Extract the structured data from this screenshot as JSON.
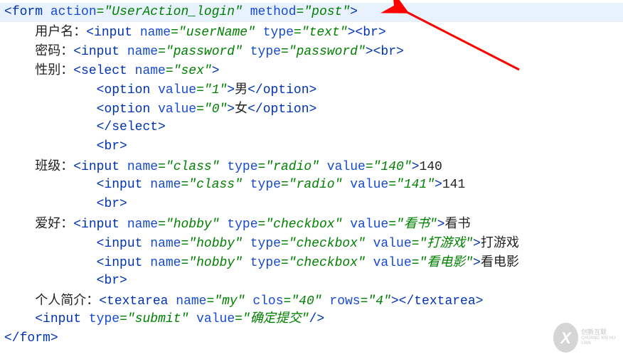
{
  "lines": [
    {
      "indent": 0,
      "tokens": [
        {
          "t": "angle",
          "v": "<"
        },
        {
          "t": "tag",
          "v": "form"
        },
        {
          "t": "txt",
          "v": " "
        },
        {
          "t": "attr",
          "v": "action"
        },
        {
          "t": "eq",
          "v": "="
        },
        {
          "t": "str",
          "v": "\"UserAction_login\""
        },
        {
          "t": "txt",
          "v": " "
        },
        {
          "t": "attr",
          "v": "method"
        },
        {
          "t": "eq",
          "v": "="
        },
        {
          "t": "str",
          "v": "\"post\""
        },
        {
          "t": "angle",
          "v": ">"
        }
      ]
    },
    {
      "indent": 1,
      "tokens": [
        {
          "t": "cjk",
          "v": "用户名："
        },
        {
          "t": "angle",
          "v": "<"
        },
        {
          "t": "tag",
          "v": "input"
        },
        {
          "t": "txt",
          "v": " "
        },
        {
          "t": "attr",
          "v": "name"
        },
        {
          "t": "eq",
          "v": "="
        },
        {
          "t": "str",
          "v": "\"userName\""
        },
        {
          "t": "txt",
          "v": " "
        },
        {
          "t": "attr",
          "v": "type"
        },
        {
          "t": "eq",
          "v": "="
        },
        {
          "t": "str",
          "v": "\"text\""
        },
        {
          "t": "angle",
          "v": ">"
        },
        {
          "t": "angle",
          "v": "<"
        },
        {
          "t": "tag",
          "v": "br"
        },
        {
          "t": "angle",
          "v": ">"
        }
      ]
    },
    {
      "indent": 1,
      "tokens": [
        {
          "t": "cjk",
          "v": "密码："
        },
        {
          "t": "angle",
          "v": "<"
        },
        {
          "t": "tag",
          "v": "input"
        },
        {
          "t": "txt",
          "v": " "
        },
        {
          "t": "attr",
          "v": "name"
        },
        {
          "t": "eq",
          "v": "="
        },
        {
          "t": "str",
          "v": "\"password\""
        },
        {
          "t": "txt",
          "v": " "
        },
        {
          "t": "attr",
          "v": "type"
        },
        {
          "t": "eq",
          "v": "="
        },
        {
          "t": "str",
          "v": "\"password\""
        },
        {
          "t": "angle",
          "v": ">"
        },
        {
          "t": "angle",
          "v": "<"
        },
        {
          "t": "tag",
          "v": "br"
        },
        {
          "t": "angle",
          "v": ">"
        }
      ]
    },
    {
      "indent": 1,
      "tokens": [
        {
          "t": "cjk",
          "v": "性别："
        },
        {
          "t": "angle",
          "v": "<"
        },
        {
          "t": "tag",
          "v": "select"
        },
        {
          "t": "txt",
          "v": " "
        },
        {
          "t": "attr",
          "v": "name"
        },
        {
          "t": "eq",
          "v": "="
        },
        {
          "t": "str",
          "v": "\"sex\""
        },
        {
          "t": "angle",
          "v": ">"
        }
      ]
    },
    {
      "indent": 3,
      "tokens": [
        {
          "t": "angle",
          "v": "<"
        },
        {
          "t": "tag",
          "v": "option"
        },
        {
          "t": "txt",
          "v": " "
        },
        {
          "t": "attr",
          "v": "value"
        },
        {
          "t": "eq",
          "v": "="
        },
        {
          "t": "str",
          "v": "\"1\""
        },
        {
          "t": "angle",
          "v": ">"
        },
        {
          "t": "cjk",
          "v": "男"
        },
        {
          "t": "angle",
          "v": "</"
        },
        {
          "t": "tag",
          "v": "option"
        },
        {
          "t": "angle",
          "v": ">"
        }
      ]
    },
    {
      "indent": 3,
      "tokens": [
        {
          "t": "angle",
          "v": "<"
        },
        {
          "t": "tag",
          "v": "option"
        },
        {
          "t": "txt",
          "v": " "
        },
        {
          "t": "attr",
          "v": "value"
        },
        {
          "t": "eq",
          "v": "="
        },
        {
          "t": "str",
          "v": "\"0\""
        },
        {
          "t": "angle",
          "v": ">"
        },
        {
          "t": "cjk",
          "v": "女"
        },
        {
          "t": "angle",
          "v": "</"
        },
        {
          "t": "tag",
          "v": "option"
        },
        {
          "t": "angle",
          "v": ">"
        }
      ]
    },
    {
      "indent": 3,
      "tokens": [
        {
          "t": "angle",
          "v": "</"
        },
        {
          "t": "tag",
          "v": "select"
        },
        {
          "t": "angle",
          "v": ">"
        }
      ]
    },
    {
      "indent": 3,
      "tokens": [
        {
          "t": "angle",
          "v": "<"
        },
        {
          "t": "tag",
          "v": "br"
        },
        {
          "t": "angle",
          "v": ">"
        }
      ]
    },
    {
      "indent": 1,
      "tokens": [
        {
          "t": "cjk",
          "v": "班级："
        },
        {
          "t": "angle",
          "v": "<"
        },
        {
          "t": "tag",
          "v": "input"
        },
        {
          "t": "txt",
          "v": " "
        },
        {
          "t": "attr",
          "v": "name"
        },
        {
          "t": "eq",
          "v": "="
        },
        {
          "t": "str",
          "v": "\"class\""
        },
        {
          "t": "txt",
          "v": " "
        },
        {
          "t": "attr",
          "v": "type"
        },
        {
          "t": "eq",
          "v": "="
        },
        {
          "t": "str",
          "v": "\"radio\""
        },
        {
          "t": "txt",
          "v": " "
        },
        {
          "t": "attr",
          "v": "value"
        },
        {
          "t": "eq",
          "v": "="
        },
        {
          "t": "str",
          "v": "\"140\""
        },
        {
          "t": "angle",
          "v": ">"
        },
        {
          "t": "txt",
          "v": "140"
        }
      ]
    },
    {
      "indent": 3,
      "tokens": [
        {
          "t": "angle",
          "v": "<"
        },
        {
          "t": "tag",
          "v": "input"
        },
        {
          "t": "txt",
          "v": " "
        },
        {
          "t": "attr",
          "v": "name"
        },
        {
          "t": "eq",
          "v": "="
        },
        {
          "t": "str",
          "v": "\"class\""
        },
        {
          "t": "txt",
          "v": " "
        },
        {
          "t": "attr",
          "v": "type"
        },
        {
          "t": "eq",
          "v": "="
        },
        {
          "t": "str",
          "v": "\"radio\""
        },
        {
          "t": "txt",
          "v": " "
        },
        {
          "t": "attr",
          "v": "value"
        },
        {
          "t": "eq",
          "v": "="
        },
        {
          "t": "str",
          "v": "\"141\""
        },
        {
          "t": "angle",
          "v": ">"
        },
        {
          "t": "txt",
          "v": "141"
        }
      ]
    },
    {
      "indent": 3,
      "tokens": [
        {
          "t": "angle",
          "v": "<"
        },
        {
          "t": "tag",
          "v": "br"
        },
        {
          "t": "angle",
          "v": ">"
        }
      ]
    },
    {
      "indent": 1,
      "tokens": [
        {
          "t": "cjk",
          "v": "爱好："
        },
        {
          "t": "angle",
          "v": "<"
        },
        {
          "t": "tag",
          "v": "input"
        },
        {
          "t": "txt",
          "v": " "
        },
        {
          "t": "attr",
          "v": "name"
        },
        {
          "t": "eq",
          "v": "="
        },
        {
          "t": "str",
          "v": "\"hobby\""
        },
        {
          "t": "txt",
          "v": " "
        },
        {
          "t": "attr",
          "v": "type"
        },
        {
          "t": "eq",
          "v": "="
        },
        {
          "t": "str",
          "v": "\"checkbox\""
        },
        {
          "t": "txt",
          "v": " "
        },
        {
          "t": "attr",
          "v": "value"
        },
        {
          "t": "eq",
          "v": "="
        },
        {
          "t": "str",
          "v": "\"看书\""
        },
        {
          "t": "angle",
          "v": ">"
        },
        {
          "t": "cjk",
          "v": "看书"
        }
      ]
    },
    {
      "indent": 3,
      "tokens": [
        {
          "t": "angle",
          "v": "<"
        },
        {
          "t": "tag",
          "v": "input"
        },
        {
          "t": "txt",
          "v": " "
        },
        {
          "t": "attr",
          "v": "name"
        },
        {
          "t": "eq",
          "v": "="
        },
        {
          "t": "str",
          "v": "\"hobby\""
        },
        {
          "t": "txt",
          "v": " "
        },
        {
          "t": "attr",
          "v": "type"
        },
        {
          "t": "eq",
          "v": "="
        },
        {
          "t": "str",
          "v": "\"checkbox\""
        },
        {
          "t": "txt",
          "v": " "
        },
        {
          "t": "attr",
          "v": "value"
        },
        {
          "t": "eq",
          "v": "="
        },
        {
          "t": "str",
          "v": "\"打游戏\""
        },
        {
          "t": "angle",
          "v": ">"
        },
        {
          "t": "cjk",
          "v": "打游戏"
        }
      ]
    },
    {
      "indent": 3,
      "tokens": [
        {
          "t": "angle",
          "v": "<"
        },
        {
          "t": "tag",
          "v": "input"
        },
        {
          "t": "txt",
          "v": " "
        },
        {
          "t": "attr",
          "v": "name"
        },
        {
          "t": "eq",
          "v": "="
        },
        {
          "t": "str",
          "v": "\"hobby\""
        },
        {
          "t": "txt",
          "v": " "
        },
        {
          "t": "attr",
          "v": "type"
        },
        {
          "t": "eq",
          "v": "="
        },
        {
          "t": "str",
          "v": "\"checkbox\""
        },
        {
          "t": "txt",
          "v": " "
        },
        {
          "t": "attr",
          "v": "value"
        },
        {
          "t": "eq",
          "v": "="
        },
        {
          "t": "str",
          "v": "\"看电影\""
        },
        {
          "t": "angle",
          "v": ">"
        },
        {
          "t": "cjk",
          "v": "看电影"
        }
      ]
    },
    {
      "indent": 3,
      "tokens": [
        {
          "t": "angle",
          "v": "<"
        },
        {
          "t": "tag",
          "v": "br"
        },
        {
          "t": "angle",
          "v": ">"
        }
      ]
    },
    {
      "indent": 1,
      "tokens": [
        {
          "t": "cjk",
          "v": "个人简介："
        },
        {
          "t": "angle",
          "v": "<"
        },
        {
          "t": "tag",
          "v": "textarea"
        },
        {
          "t": "txt",
          "v": " "
        },
        {
          "t": "attr",
          "v": "name"
        },
        {
          "t": "eq",
          "v": "="
        },
        {
          "t": "str",
          "v": "\"my\""
        },
        {
          "t": "txt",
          "v": " "
        },
        {
          "t": "attr",
          "v": "clos"
        },
        {
          "t": "eq",
          "v": "="
        },
        {
          "t": "str",
          "v": "\"40\""
        },
        {
          "t": "txt",
          "v": " "
        },
        {
          "t": "attr",
          "v": "rows"
        },
        {
          "t": "eq",
          "v": "="
        },
        {
          "t": "str",
          "v": "\"4\""
        },
        {
          "t": "angle",
          "v": ">"
        },
        {
          "t": "angle",
          "v": "</"
        },
        {
          "t": "tag",
          "v": "textarea"
        },
        {
          "t": "angle",
          "v": ">"
        }
      ]
    },
    {
      "indent": 1,
      "tokens": [
        {
          "t": "angle",
          "v": "<"
        },
        {
          "t": "tag",
          "v": "input"
        },
        {
          "t": "txt",
          "v": " "
        },
        {
          "t": "attr",
          "v": "type"
        },
        {
          "t": "eq",
          "v": "="
        },
        {
          "t": "str",
          "v": "\"submit\""
        },
        {
          "t": "txt",
          "v": " "
        },
        {
          "t": "attr",
          "v": "value"
        },
        {
          "t": "eq",
          "v": "="
        },
        {
          "t": "str",
          "v": "\"确定提交\""
        },
        {
          "t": "angle",
          "v": "/>"
        }
      ]
    },
    {
      "indent": 0,
      "tokens": [
        {
          "t": "angle",
          "v": "</"
        },
        {
          "t": "tag",
          "v": "form"
        },
        {
          "t": "angle",
          "v": ">"
        }
      ]
    }
  ],
  "watermark": {
    "icon": "X",
    "line1": "创新互联",
    "line2": "CHUANG XIN HU LIAN"
  }
}
